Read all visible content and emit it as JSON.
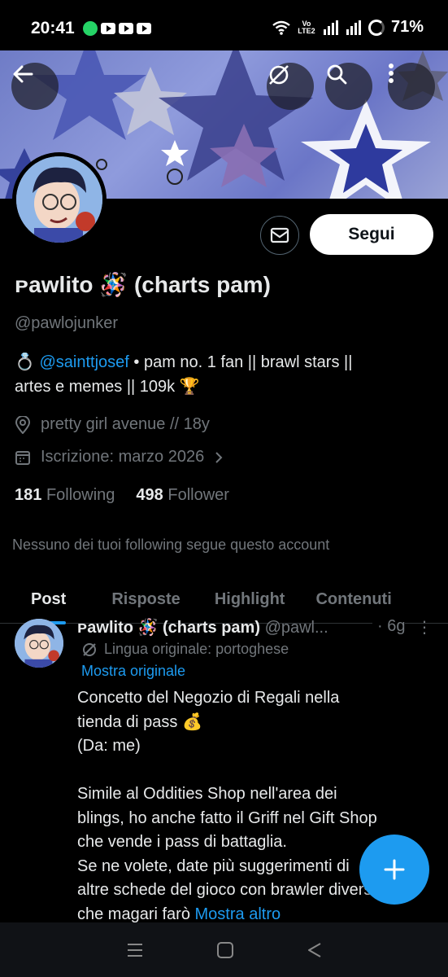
{
  "status_bar": {
    "time": "20:41",
    "network": "Vo LTE2",
    "battery": "71%"
  },
  "profile": {
    "display_name": "ᴘawlito 🪅 (charts pam)",
    "handle": "@pawlojunker",
    "follow_label": "Segui",
    "bio_emoji": "💍",
    "bio_mention": "@sainttjosef",
    "bio_line1_rest": " • pam no. 1 fan  || brawl stars ||",
    "bio_line2": "artes e memes || 109k 🏆",
    "location": "pretty girl avenue // 18y",
    "joined": "Iscrizione: marzo 2026",
    "following_count": "181",
    "following_label": "Following",
    "followers_count": "498",
    "followers_label": "Follower",
    "no_mutuals": "Nessuno dei tuoi following segue questo account"
  },
  "tabs": [
    {
      "label": "Post",
      "active": true
    },
    {
      "label": "Risposte",
      "active": false
    },
    {
      "label": "Highlight",
      "active": false
    },
    {
      "label": "Contenuti",
      "active": false
    }
  ],
  "tweet": {
    "name": "ᴘawlito 🪅 (charts pam)",
    "handle": "@pawl...",
    "time": "· 6g",
    "more": "⋮",
    "translated_note": "Lingua originale: portoghese",
    "show_original": "Mostra originale",
    "lines": [
      "Concetto del Negozio di Regali nella",
      "tienda di pass 💰",
      "(Da: me)",
      "",
      "Simile al Oddities Shop nell'area dei",
      "blings, ho anche fatto il Griff nel Gift Shop",
      "che vende i pass di battaglia.",
      "Se ne volete, date più suggerimenti di",
      "altre schede del gioco con brawler diversi"
    ],
    "last_line": "che magari farò ",
    "show_more": "Mostra altro"
  },
  "icons": {
    "back": "back-arrow-icon",
    "mute": "notifications-off-icon",
    "search": "search-icon",
    "more": "more-vertical-icon",
    "message": "envelope-icon",
    "location": "location-pin-icon",
    "calendar": "calendar-icon",
    "compose": "plus-icon"
  },
  "colors": {
    "accent": "#1d9bf0",
    "background": "#000000",
    "muted_text": "#71767b"
  }
}
